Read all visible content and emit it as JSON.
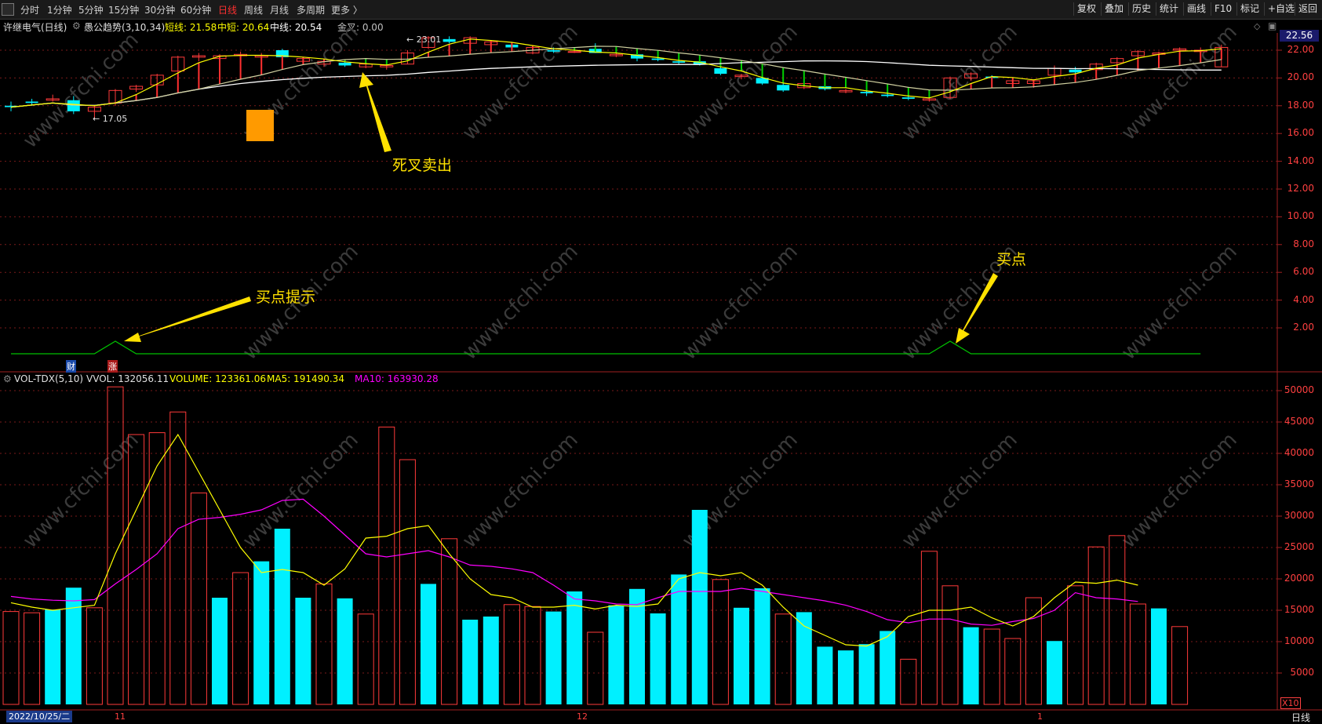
{
  "toolbar": {
    "periods": [
      "分时",
      "1分钟",
      "5分钟",
      "15分钟",
      "30分钟",
      "60分钟",
      "日线",
      "周线",
      "月线",
      "多周期",
      "更多 〉"
    ],
    "active_period": "日线",
    "right_buttons": [
      "复权",
      "叠加",
      "历史",
      "统计",
      "画线",
      "F10",
      "标记",
      "+自选",
      "返回"
    ]
  },
  "info": {
    "stock": "许继电气(日线)",
    "indicator": "愚公趋势(3,10,34)",
    "short_label": "短线: 21.58",
    "mid_short_label": "中短: 20.64",
    "mid_label": "中线: 20.54",
    "golden_label": "金叉: 0.00"
  },
  "vol_info": {
    "name": "VOL-TDX(5,10)",
    "vvol": "VVOL: 132056.11",
    "volume": "VOLUME: 123361.06",
    "ma5": "MA5: 191490.34",
    "ma10": "MA10: 163930.28"
  },
  "price_axis": [
    "22.00",
    "20.00",
    "18.00",
    "16.00",
    "14.00",
    "12.00",
    "10.00",
    "8.00",
    "6.00",
    "4.00",
    "2.00"
  ],
  "current_price": "22.56",
  "vol_axis": [
    "50000",
    "45000",
    "40000",
    "35000",
    "30000",
    "25000",
    "20000",
    "15000",
    "10000",
    "5000"
  ],
  "vol_unit": "X10",
  "period_corner": "日线",
  "dates": {
    "start": "2022/10/25/二",
    "m11": "11",
    "m12": "12",
    "m1": "1"
  },
  "markers": {
    "cai": "财",
    "zhang": "涨",
    "high": "23.01",
    "low": "17.05"
  },
  "annotations": {
    "dead_cross": "死叉卖出",
    "buy_hint": "买点提示",
    "buy_point": "买点"
  },
  "watermark": "www.cfchi.com",
  "colors": {
    "up": "#ff3a3a",
    "down": "#00f0ff",
    "ma5": "#ffff00",
    "ma10": "#ff00ff",
    "short": "#ffff00",
    "mid": "#ffffff",
    "signal": "#00c000"
  },
  "chart_data": [
    {
      "type": "candlestick",
      "title": "许继电气(日线)",
      "ylim": [
        0,
        23.5
      ],
      "candles": [
        [
          18.0,
          18.3,
          17.6,
          17.9
        ],
        [
          18.3,
          18.5,
          18.0,
          18.2
        ],
        [
          18.4,
          18.8,
          18.3,
          18.5
        ],
        [
          18.4,
          18.7,
          17.4,
          17.6
        ],
        [
          17.6,
          18.0,
          17.05,
          17.9
        ],
        [
          18.2,
          19.2,
          18.0,
          19.1
        ],
        [
          19.2,
          19.5,
          19.0,
          19.4
        ],
        [
          19.5,
          20.3,
          19.4,
          20.2
        ],
        [
          20.5,
          21.6,
          20.4,
          21.5
        ],
        [
          21.5,
          21.8,
          21.2,
          21.6
        ],
        [
          21.4,
          21.7,
          21.3,
          21.6
        ],
        [
          21.6,
          21.9,
          21.4,
          21.7
        ],
        [
          21.5,
          21.8,
          21.3,
          21.6
        ],
        [
          22.0,
          22.1,
          21.4,
          21.5
        ],
        [
          21.2,
          21.5,
          21.0,
          21.4
        ],
        [
          21.0,
          21.3,
          20.8,
          21.2
        ],
        [
          21.1,
          21.2,
          20.8,
          20.9
        ],
        [
          20.8,
          21.2,
          20.7,
          21.0
        ],
        [
          20.8,
          21.1,
          20.6,
          20.9
        ],
        [
          21.0,
          22.0,
          21.0,
          21.8
        ],
        [
          22.2,
          23.01,
          22.1,
          22.9
        ],
        [
          22.8,
          23.0,
          22.5,
          22.6
        ],
        [
          22.5,
          23.0,
          22.4,
          22.9
        ],
        [
          22.4,
          22.7,
          22.3,
          22.6
        ],
        [
          22.4,
          22.6,
          22.1,
          22.2
        ],
        [
          21.8,
          22.3,
          21.7,
          22.2
        ],
        [
          22.0,
          22.2,
          21.8,
          21.9
        ],
        [
          21.9,
          22.0,
          21.8,
          21.9
        ],
        [
          22.1,
          22.5,
          21.8,
          21.8
        ],
        [
          21.6,
          21.9,
          21.5,
          21.7
        ],
        [
          21.7,
          21.9,
          21.2,
          21.4
        ],
        [
          21.4,
          21.6,
          21.2,
          21.3
        ],
        [
          21.2,
          21.4,
          21.0,
          21.1
        ],
        [
          21.2,
          21.4,
          20.9,
          21.0
        ],
        [
          20.7,
          20.9,
          20.2,
          20.3
        ],
        [
          20.1,
          20.3,
          19.9,
          20.2
        ],
        [
          20.0,
          20.1,
          19.5,
          19.6
        ],
        [
          19.5,
          19.7,
          19.0,
          19.1
        ],
        [
          19.3,
          19.8,
          19.2,
          19.6
        ],
        [
          19.4,
          19.6,
          19.1,
          19.2
        ],
        [
          19.0,
          19.2,
          18.9,
          19.1
        ],
        [
          19.0,
          19.2,
          18.7,
          18.9
        ],
        [
          18.8,
          19.1,
          18.6,
          18.7
        ],
        [
          18.6,
          18.9,
          18.4,
          18.5
        ],
        [
          18.4,
          18.7,
          18.3,
          18.5
        ],
        [
          18.6,
          20.1,
          18.5,
          20.0
        ],
        [
          20.0,
          20.4,
          19.8,
          20.3
        ],
        [
          20.1,
          20.2,
          19.9,
          20.0
        ],
        [
          19.6,
          19.9,
          19.4,
          19.8
        ],
        [
          19.6,
          19.9,
          19.3,
          19.8
        ],
        [
          20.2,
          20.9,
          20.0,
          20.7
        ],
        [
          20.6,
          20.8,
          20.3,
          20.4
        ],
        [
          20.6,
          21.1,
          20.5,
          21.0
        ],
        [
          21.1,
          21.5,
          20.9,
          21.4
        ],
        [
          21.6,
          22.0,
          21.4,
          21.9
        ],
        [
          21.7,
          21.9,
          21.5,
          21.8
        ],
        [
          22.0,
          22.2,
          21.8,
          22.1
        ],
        [
          21.9,
          22.2,
          21.8,
          22.0
        ],
        [
          20.8,
          22.4,
          20.8,
          22.2
        ]
      ]
    },
    {
      "type": "line",
      "name": "signal",
      "values": [
        0,
        0,
        0,
        0,
        0,
        1,
        0,
        0,
        0,
        0,
        0,
        0,
        0,
        0,
        0,
        0,
        0,
        0,
        0,
        0,
        0,
        0,
        0,
        0,
        0,
        0,
        0,
        0,
        0,
        0,
        0,
        0,
        0,
        0,
        0,
        0,
        0,
        0,
        0,
        0,
        0,
        0,
        0,
        0,
        0,
        1,
        0,
        0,
        0,
        0,
        0,
        0,
        0,
        0,
        0,
        0,
        0,
        0
      ]
    },
    {
      "type": "bar",
      "ylabel": "VOLUME",
      "ylim": [
        0,
        53000
      ],
      "values": [
        14800,
        14600,
        15100,
        18600,
        15400,
        50600,
        43000,
        43300,
        46600,
        33700,
        17000,
        21000,
        22800,
        28000,
        17000,
        19200,
        16900,
        14400,
        44200,
        39000,
        19200,
        26400,
        13500,
        14000,
        15900,
        15600,
        14800,
        18000,
        11500,
        15800,
        18400,
        14500,
        20700,
        31000,
        19900,
        15400,
        18500,
        14400,
        14700,
        9200,
        8600,
        9600,
        11700,
        7200,
        24400,
        18900,
        12300,
        12000,
        10500,
        17000,
        10100,
        18900,
        25100,
        26900,
        16000,
        15300,
        12400
      ],
      "up": [
        1,
        1,
        0,
        0,
        1,
        1,
        1,
        1,
        1,
        1,
        0,
        1,
        0,
        0,
        0,
        1,
        0,
        1,
        1,
        1,
        0,
        1,
        0,
        0,
        1,
        1,
        0,
        0,
        1,
        0,
        0,
        0,
        0,
        0,
        1,
        0,
        0,
        1,
        0,
        0,
        0,
        0,
        0,
        1,
        1,
        1,
        0,
        1,
        1,
        1,
        0,
        1,
        1,
        1,
        1,
        0,
        1
      ],
      "ma5": [
        16200,
        15500,
        15000,
        15400,
        15800,
        24000,
        31000,
        38000,
        43000,
        37000,
        31000,
        25000,
        21000,
        21500,
        21000,
        19000,
        21600,
        26500,
        26800,
        28000,
        28500,
        24000,
        20000,
        17500,
        17000,
        15500,
        15500,
        15800,
        15200,
        15800,
        15600,
        16000,
        20000,
        21000,
        20500,
        21000,
        19000,
        15500,
        12500,
        11000,
        9500,
        9300,
        10800,
        14000,
        15000,
        15000,
        15500,
        13800,
        12500,
        14000,
        17000,
        19500,
        19300,
        19800,
        19000
      ],
      "ma10": [
        17200,
        16800,
        16600,
        16500,
        16700,
        19200,
        21500,
        24000,
        28000,
        29500,
        29800,
        30300,
        31000,
        32500,
        32700,
        30000,
        27000,
        24000,
        23500,
        24000,
        24500,
        23500,
        22200,
        22000,
        21600,
        21000,
        19000,
        16800,
        16500,
        16000,
        15900,
        17000,
        18000,
        18000,
        18000,
        18500,
        18000,
        17500,
        17000,
        16500,
        15800,
        14800,
        13500,
        13000,
        13600,
        13600,
        12800,
        12600,
        13200,
        13700,
        15000,
        17800,
        17000,
        16800,
        16400
      ]
    }
  ]
}
